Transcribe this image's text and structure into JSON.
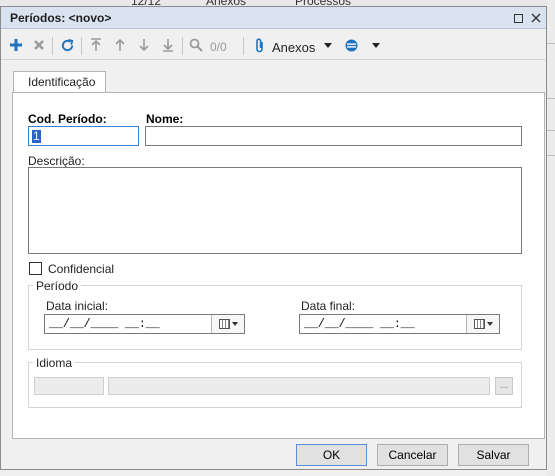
{
  "background": {
    "frag1": "12/12",
    "frag2": "Anexos",
    "frag3": "Processos"
  },
  "dialog": {
    "title": "Períodos: <novo>"
  },
  "toolbar": {
    "counter": "0/0",
    "attachments_label": "Anexos",
    "icons": [
      "plus-icon",
      "delete-x-icon",
      "refresh-icon",
      "first-record-icon",
      "previous-record-icon",
      "next-record-icon",
      "last-record-icon",
      "search-icon",
      "paperclip-icon",
      "caret-down-icon",
      "options-icon",
      "caret-down-icon"
    ],
    "accent_color": "#1e73be"
  },
  "tabs": [
    {
      "label": "Identificação"
    }
  ],
  "form": {
    "cod_periodo_label": "Cod. Período:",
    "cod_periodo_value": "1",
    "nome_label": "Nome:",
    "nome_value": "",
    "descricao_label": "Descrição:",
    "descricao_value": "",
    "confidencial_label": "Confidencial",
    "confidencial_checked": false,
    "periodo_group": "Período",
    "data_inicial_label": "Data inicial:",
    "data_inicial_value": "__/__/____ __:__",
    "data_final_label": "Data final:",
    "data_final_value": "__/__/____ __:__",
    "idioma_group": "Idioma",
    "idioma_code": "",
    "idioma_name": "",
    "idioma_lookup_label": "..."
  },
  "buttons": {
    "ok": "OK",
    "cancel": "Cancelar",
    "save": "Salvar"
  }
}
